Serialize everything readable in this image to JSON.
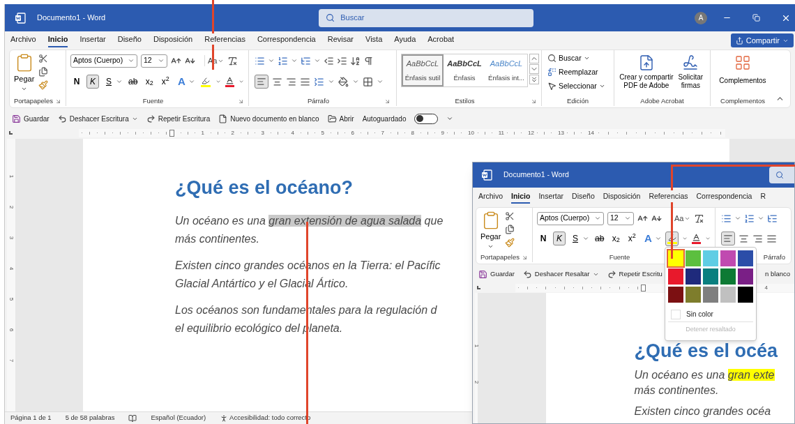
{
  "window": {
    "title": "Documento1 - Word",
    "search_placeholder": "Buscar",
    "avatar": "A"
  },
  "menu": [
    {
      "label": "Archivo",
      "selected": false
    },
    {
      "label": "Inicio",
      "selected": true
    },
    {
      "label": "Insertar",
      "selected": false
    },
    {
      "label": "Diseño",
      "selected": false
    },
    {
      "label": "Disposición",
      "selected": false
    },
    {
      "label": "Referencias",
      "selected": false
    },
    {
      "label": "Correspondencia",
      "selected": false
    },
    {
      "label": "Revisar",
      "selected": false
    },
    {
      "label": "Vista",
      "selected": false
    },
    {
      "label": "Ayuda",
      "selected": false
    },
    {
      "label": "Acrobat",
      "selected": false
    }
  ],
  "share_button": "Compartir",
  "ribbon": {
    "clipboard": {
      "paste": "Pegar",
      "label": "Portapapeles"
    },
    "font": {
      "label": "Fuente",
      "font_name": "Aptos (Cuerpo)",
      "font_size": "12",
      "case_button": "Aa",
      "highlight_pressed": false,
      "format_buttons": [
        {
          "kind": "bold",
          "label": "N",
          "pressed": false
        },
        {
          "kind": "italic",
          "label": "K",
          "pressed": true
        },
        {
          "kind": "underline",
          "label": "S",
          "pressed": false
        },
        {
          "kind": "strike",
          "label": "ab",
          "pressed": false
        },
        {
          "kind": "sub",
          "label": "x$_{2}$",
          "pressed": false
        },
        {
          "kind": "sup",
          "label": "x$^{2}$",
          "pressed": false
        },
        {
          "kind": "effects",
          "label": "A",
          "pressed": false
        }
      ]
    },
    "paragraph": {
      "label": "Párrafo",
      "align_left_pressed": true
    },
    "styles": {
      "label": "Estilos",
      "items": [
        {
          "kind": "subtle",
          "preview": "AaBbCcL",
          "name": "Énfasis sutil",
          "selected": true
        },
        {
          "kind": "emphasis",
          "preview": "AaBbCcL",
          "name": "Énfasis",
          "selected": false
        },
        {
          "kind": "intense",
          "preview": "AaBbCcL",
          "name": "Énfasis int...",
          "selected": false
        }
      ]
    },
    "editing": {
      "label": "Edición",
      "items": [
        {
          "kind": "find",
          "label": "Buscar"
        },
        {
          "kind": "replace",
          "label": "Reemplazar"
        },
        {
          "kind": "select",
          "label": "Seleccionar"
        }
      ]
    },
    "acrobat": {
      "label": "Adobe Acrobat",
      "items": [
        {
          "kind": "pdf",
          "label": "Crear y compartir PDF de Adobe"
        },
        {
          "kind": "sign",
          "label": "Solicitar firmas"
        }
      ]
    },
    "addins": {
      "label": "Complementos",
      "button": "Complementos"
    }
  },
  "quick_access": {
    "items": [
      {
        "kind": "save",
        "label": "Guardar"
      },
      {
        "kind": "undo",
        "label": "Deshacer Escritura"
      },
      {
        "kind": "redo",
        "label": "Repetir Escritura"
      },
      {
        "kind": "new",
        "label": "Nuevo documento en blanco"
      },
      {
        "kind": "open",
        "label": "Abrir"
      }
    ],
    "autosave": {
      "label": "Autoguardado",
      "on": false
    }
  },
  "ruler": [
    "1",
    "2",
    "3",
    "4",
    "5",
    "6",
    "7",
    "8",
    "9",
    "10",
    "11",
    "12",
    "13",
    "14"
  ],
  "vertical_ruler": [
    "1",
    "2",
    "3",
    "4",
    "5",
    "6",
    "7"
  ],
  "document": {
    "heading": "¿Qué es el océano?",
    "paragraphs": [
      {
        "lines": [
          [
            {
              "text": "Un océano es una ",
              "selected": false
            },
            {
              "text": "gran extensión de agua salada",
              "selected": true
            },
            {
              "text": " que",
              "selected": false
            }
          ],
          [
            {
              "text": "más continentes.",
              "selected": false
            }
          ]
        ]
      },
      {
        "lines": [
          [
            {
              "text": "Existen cinco grandes océanos en la Tierra: el Pacífic",
              "selected": false
            }
          ],
          [
            {
              "text": "Glacial Antártico y el Glacial Ártico.",
              "selected": false
            }
          ]
        ]
      },
      {
        "lines": [
          [
            {
              "text": "Los océanos son fundamentales para la regulación d",
              "selected": false
            }
          ],
          [
            {
              "text": "el equilibrio ecológico del planeta.",
              "selected": false
            }
          ]
        ]
      }
    ]
  },
  "status_bar": [
    {
      "kind": "text",
      "label": "Página 1 de 1"
    },
    {
      "kind": "text",
      "label": "5 de 58 palabras"
    },
    {
      "kind": "book"
    },
    {
      "kind": "text",
      "label": "Español (Ecuador)"
    },
    {
      "kind": "accessibility",
      "label": "Accesibilidad: todo correcto"
    }
  ],
  "inset_window": {
    "title": "Documento1 - Word",
    "menu": [
      {
        "label": "Archivo",
        "selected": false
      },
      {
        "label": "Inicio",
        "selected": true
      },
      {
        "label": "Insertar",
        "selected": false
      },
      {
        "label": "Diseño",
        "selected": false
      },
      {
        "label": "Disposición",
        "selected": false
      },
      {
        "label": "Referencias",
        "selected": false
      },
      {
        "label": "Correspondencia",
        "selected": false
      },
      {
        "label": "R",
        "selected": false
      }
    ],
    "clipboard": {
      "paste": "Pegar",
      "label": "Portapapeles"
    },
    "font": {
      "label": "Fuente",
      "font_name": "Aptos (Cuerpo)",
      "font_size": "12",
      "case_button": "Aa",
      "highlight_pressed": true,
      "format_buttons": [
        {
          "kind": "bold",
          "label": "N",
          "pressed": false
        },
        {
          "kind": "italic",
          "label": "K",
          "pressed": true
        },
        {
          "kind": "underline",
          "label": "S",
          "pressed": false
        },
        {
          "kind": "strike",
          "label": "ab",
          "pressed": false
        },
        {
          "kind": "sub",
          "label": "x$_{2}$",
          "pressed": false
        },
        {
          "kind": "sup",
          "label": "x$^{2}$",
          "pressed": false
        },
        {
          "kind": "effects",
          "label": "A",
          "pressed": false
        }
      ]
    },
    "paragraph": {
      "label": "Párrafo",
      "align_left_pressed": true
    },
    "quick_access": [
      {
        "kind": "save",
        "label": "Guardar"
      },
      {
        "kind": "undo",
        "label": "Deshacer Resaltar"
      },
      {
        "kind": "redo",
        "label": "Repetir Escritu"
      },
      {
        "kind": "fragment",
        "label": "n blanco"
      }
    ],
    "ruler": [
      "4"
    ],
    "vertical_ruler": [
      "1",
      "2"
    ],
    "highlight_palette": {
      "swatches": [
        {
          "color": "#ffff00",
          "selected": true
        },
        {
          "color": "#5cbf3f",
          "selected": false
        },
        {
          "color": "#5fcde4",
          "selected": false
        },
        {
          "color": "#c04ab0",
          "selected": false
        },
        {
          "color": "#2b4da8",
          "selected": false
        },
        {
          "color": "#e8192c",
          "selected": false
        },
        {
          "color": "#1f2a7c",
          "selected": false
        },
        {
          "color": "#0a7f7f",
          "selected": false
        },
        {
          "color": "#0d7a34",
          "selected": false
        },
        {
          "color": "#7a1f86",
          "selected": false
        },
        {
          "color": "#7c1012",
          "selected": false
        },
        {
          "color": "#7e7d2c",
          "selected": false
        },
        {
          "color": "#7f7f7f",
          "selected": false
        },
        {
          "color": "#c0c0c0",
          "selected": false
        },
        {
          "color": "#000000",
          "selected": false
        }
      ],
      "no_color": "Sin color",
      "stop": "Detener resaltado",
      "stop_disabled": true
    },
    "document": {
      "heading": "¿Qué es el océa",
      "paragraphs": [
        {
          "lines": [
            [
              {
                "text": "Un océano es una ",
                "highlighted": false
              },
              {
                "text": "gran exte",
                "highlighted": true
              }
            ],
            [
              {
                "text": "más continentes.",
                "highlighted": false
              }
            ]
          ]
        },
        {
          "lines": [
            [
              {
                "text": "Existen cinco grandes océa",
                "highlighted": false
              }
            ]
          ]
        }
      ]
    }
  }
}
